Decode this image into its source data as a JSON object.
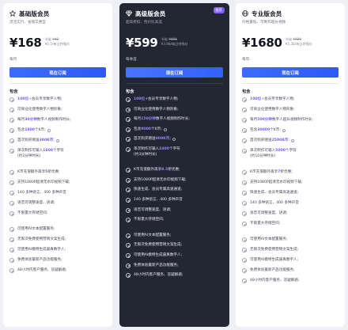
{
  "plans": [
    {
      "name": "基础版会员",
      "icon": "star-icon",
      "desc": "灵活实行、省钱又便宜",
      "price": "¥168",
      "orig_prefix": "节省",
      "orig": "¥42",
      "daily": "¥0.5/每日特殊价",
      "period": "每月",
      "button": "现在订阅",
      "include": "包含",
      "features": [
        {
          "pre": "",
          "hl": "100位",
          "post": "+会员专享数字人物;"
        },
        {
          "pre": "可商业化使用数字人物形象;",
          "hl": "",
          "post": ""
        },
        {
          "pre": "每月",
          "hl": "30分钟",
          "post": "数字人视频制作时长;"
        },
        {
          "pre": "包含",
          "hl": "1800",
          "post": "个K币;",
          "info": true
        },
        {
          "pre": "首次购买赠送",
          "hl": "300K币",
          "post": ";",
          "info": true
        },
        {
          "pre": "单次制作可输入",
          "hl": "1600",
          "post": "个字符",
          "sub": "(约2分钟时长)"
        },
        {
          "pre": "K币充值额外再享",
          "hl": "5",
          "post": "折优惠;"
        },
        {
          "pre": "支持1080P超清无水印视频下载;",
          "hl": "",
          "post": ""
        },
        {
          "pre": "140 多种语言、400 多种声音",
          "hl": "",
          "post": ""
        },
        {
          "pre": "语音可调整速度、语调;",
          "hl": "",
          "post": ""
        },
        {
          "pre": "不限量大存储空间;",
          "hl": "",
          "post": ""
        },
        {
          "pre": "可使用AI文本配置服务;",
          "hl": "",
          "post": ""
        },
        {
          "pre": "无限次免费使用营销文案生成;",
          "hl": "",
          "post": ""
        },
        {
          "pre": "可使用AI模特生成逼真数字人;",
          "hl": "",
          "post": ""
        },
        {
          "pre": "免费体验最新产品功能服务;",
          "hl": "",
          "post": ""
        },
        {
          "pre": "48小时内客户服务、答疑解惑;",
          "hl": "",
          "post": ""
        }
      ]
    },
    {
      "name": "高级版会员",
      "icon": "diamond-icon",
      "badge": "推荐",
      "desc": "超高折扣、性价比高选",
      "price": "¥599",
      "orig_prefix": "节省",
      "orig": "¥491",
      "daily": "¥3.98/每日特殊价",
      "period": "每季度",
      "button": "现在订阅",
      "include": "包含",
      "features": [
        {
          "pre": "",
          "hl": "100位",
          "post": "+会员专享数字人物;"
        },
        {
          "pre": "可商业化使用数字人物形象;",
          "hl": "",
          "post": ""
        },
        {
          "pre": "每月",
          "hl": "150分钟",
          "post": "数字人视频制作时长;"
        },
        {
          "pre": "包含",
          "hl": "9000",
          "post": "个K币;",
          "info": true
        },
        {
          "pre": "首次购买赠送",
          "hl": "900K币",
          "post": ";",
          "info": true
        },
        {
          "pre": "单次制作可输入",
          "hl": "2400",
          "post": "个字符",
          "sub": "(约3分钟时长)"
        },
        {
          "pre": "K币充值额外再享",
          "hl": "8.5",
          "post": "折优惠;"
        },
        {
          "pre": "支持1080P超清无水印视频下载;",
          "hl": "",
          "post": ""
        },
        {
          "pre": "快速生成、会员专属高速通道;",
          "hl": "",
          "post": ""
        },
        {
          "pre": "140 多种语言、400 多种声音",
          "hl": "",
          "post": ""
        },
        {
          "pre": "语音可调整速度、语调;",
          "hl": "",
          "post": ""
        },
        {
          "pre": "不限量大存储空间;",
          "hl": "",
          "post": ""
        },
        {
          "pre": "可使用AI文本配置服务;",
          "hl": "",
          "post": ""
        },
        {
          "pre": "无限次免费使用营销文案生成;",
          "hl": "",
          "post": ""
        },
        {
          "pre": "可使用AI模特生成逼真数字人;",
          "hl": "",
          "post": ""
        },
        {
          "pre": "免费体验最新产品功能服务;",
          "hl": "",
          "post": ""
        },
        {
          "pre": "48小时内客户服务、答疑解惑;",
          "hl": "",
          "post": ""
        }
      ]
    },
    {
      "name": "专业版会员",
      "icon": "globe-icon",
      "desc": "价格最低、可制作超长视频",
      "price": "¥1680",
      "orig_prefix": "节省",
      "orig": "¥820",
      "daily": "¥5.38/每日特殊价",
      "period": "每年",
      "button": "现在订阅",
      "include": "包含",
      "features": [
        {
          "pre": "",
          "hl": "100位",
          "post": "+会员专享数字人物;"
        },
        {
          "pre": "可商业化使用数字人物形象;",
          "hl": "",
          "post": ""
        },
        {
          "pre": "每月",
          "hl": "500分钟",
          "post": "数字人超长视频制作时长;"
        },
        {
          "pre": "包含",
          "hl": "30000",
          "post": "个K币;",
          "info": true
        },
        {
          "pre": "首次购买赠送",
          "hl": "2500K币",
          "post": ";",
          "info": true
        },
        {
          "pre": "单次制作可输入",
          "hl": "5000",
          "post": "个字符",
          "sub": "(约10分钟时长)"
        },
        {
          "pre": "K币充值额外再享",
          "hl": "7",
          "post": "折优惠;"
        },
        {
          "pre": "支持1080P超清无水印视频下载;",
          "hl": "",
          "post": ""
        },
        {
          "pre": "快速生成、会员专属高速通道;",
          "hl": "",
          "post": ""
        },
        {
          "pre": "140 多种语言、400 多种声音",
          "hl": "",
          "post": ""
        },
        {
          "pre": "语音可调整速度、语调;",
          "hl": "",
          "post": ""
        },
        {
          "pre": "不限量大存储空间;",
          "hl": "",
          "post": ""
        },
        {
          "pre": "可使用AI文本配置服务;",
          "hl": "",
          "post": ""
        },
        {
          "pre": "无限次免费使用营销文案生成;",
          "hl": "",
          "post": ""
        },
        {
          "pre": "可使用AI模特生成逼真数字人;",
          "hl": "",
          "post": ""
        },
        {
          "pre": "免费体验最新产品功能服务;",
          "hl": "",
          "post": ""
        },
        {
          "pre": "48小时内客户服务、答疑解惑;",
          "hl": "",
          "post": ""
        }
      ]
    }
  ],
  "colors": {
    "accent": "#3360ff",
    "highlight": "#7b5cff",
    "dark_card": "#232633"
  }
}
